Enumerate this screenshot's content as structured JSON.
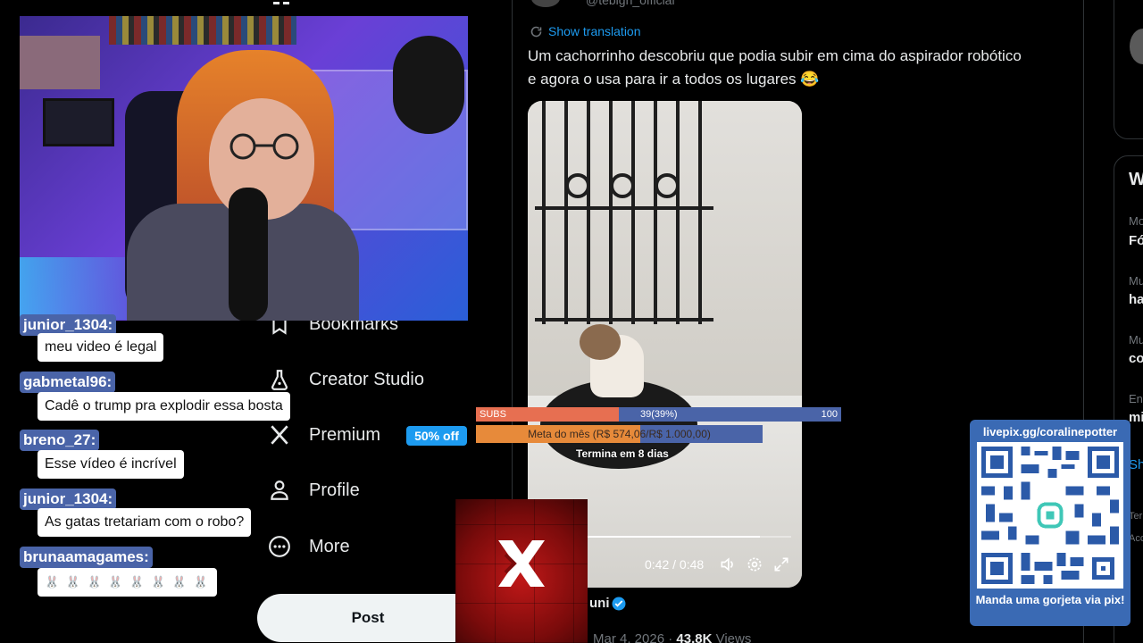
{
  "sidebar": {
    "items": [
      {
        "label": "Bookmarks",
        "icon": "bookmark-icon"
      },
      {
        "label": "Creator Studio",
        "icon": "flask-icon"
      },
      {
        "label": "Premium",
        "icon": "x-logo-icon"
      },
      {
        "label": "Profile",
        "icon": "person-icon"
      },
      {
        "label": "More",
        "icon": "more-circle-icon"
      }
    ],
    "premium_badge": "50% off",
    "post_label": "Post"
  },
  "tweet": {
    "handle_partial": "@tebigh_official",
    "show_translation": "Show translation",
    "text": "Um cachorrinho descobriu que podia subir em cima do aspirador robótico e agora o usa para ir a todos os lugares 😂",
    "video_time": "0:42 / 0:48",
    "video_progress": 0.875,
    "author_partial": "uni",
    "date_partial": "Mar 4, 2026 · ",
    "views_count": "43.8K",
    "views_label": " Views"
  },
  "right_column": {
    "card_title_partial": "W",
    "trends": [
      {
        "context": "Mo",
        "name": "Fó"
      },
      {
        "context": "Mu",
        "name": "ha"
      },
      {
        "context": "Mu",
        "name": "co"
      },
      {
        "context": "En",
        "name": "mi"
      }
    ],
    "show_more_partial": "Sh",
    "footer_1": "Ter",
    "footer_2": "Acc"
  },
  "chat": {
    "messages": [
      {
        "user": "junior_1304:",
        "text": "meu video é legal"
      },
      {
        "user": "gabmetal96:",
        "text": "Cadê o trump pra explodir essa bosta"
      },
      {
        "user": "breno_27:",
        "text": "Esse vídeo é incrível"
      },
      {
        "user": "junior_1304:",
        "text": "As gatas tretariam com o robo?"
      },
      {
        "user": "brunaamagames:",
        "text": "🐰 🐰 🐰 🐰 🐰 🐰 🐰 🐰"
      }
    ]
  },
  "overlay": {
    "subs_label": "SUBS",
    "subs_progress": "39(39%)",
    "subs_goal": "100",
    "subs_fraction": 0.39,
    "goal_label": "Meta do mês (R$ 574,06/R$ 1.000,00)",
    "goal_fraction": 0.574,
    "goal_ends": "Termina em 8 dias",
    "livepix_url": "livepix.gg/coralinepotter",
    "livepix_cta": "Manda uma gorjeta via pix!"
  },
  "colors": {
    "accent": "#1d9bf0",
    "chat_user_bg": "#4a64a8",
    "subs_fill": "#e76f51",
    "livepix_bg": "#3a6ab4"
  }
}
